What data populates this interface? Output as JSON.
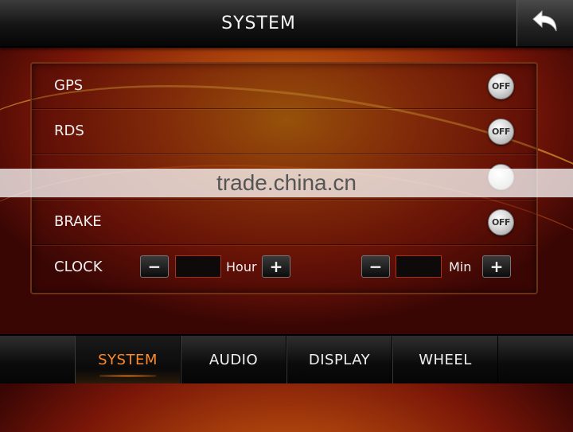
{
  "header": {
    "title": "SYSTEM"
  },
  "icons": {
    "back": "back-arrow-icon"
  },
  "settings": {
    "rows": [
      {
        "label": "GPS",
        "toggle": "OFF"
      },
      {
        "label": "RDS",
        "toggle": "OFF"
      },
      {
        "label": "",
        "toggle": ""
      },
      {
        "label": "BRAKE",
        "toggle": "OFF"
      }
    ],
    "clock": {
      "label": "CLOCK",
      "hour_unit": "Hour",
      "min_unit": "Min",
      "hour_value": "",
      "min_value": "",
      "minus": "−",
      "plus": "+"
    }
  },
  "watermark": "trade.china.cn",
  "tabs": [
    {
      "label": "SYSTEM",
      "active": true
    },
    {
      "label": "AUDIO",
      "active": false
    },
    {
      "label": "DISPLAY",
      "active": false
    },
    {
      "label": "WHEEL",
      "active": false
    }
  ],
  "colors": {
    "accent": "#ff8a2a",
    "background": "#a8400c"
  }
}
